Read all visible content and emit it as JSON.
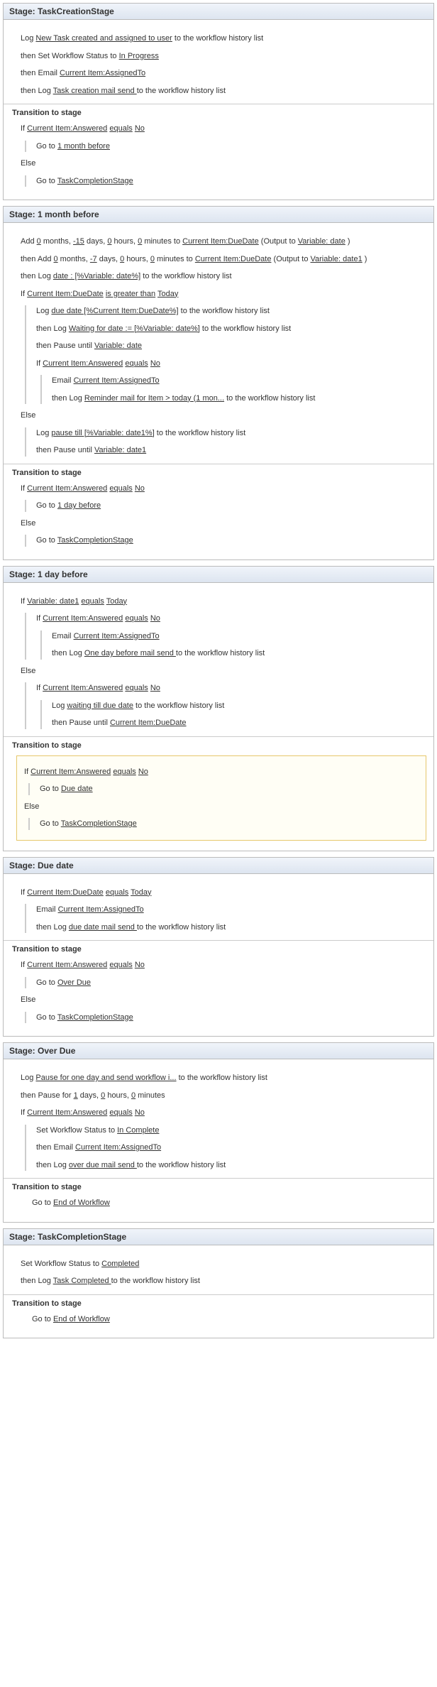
{
  "stages": {
    "creation": {
      "title": "Stage: TaskCreationStage",
      "log1_pre": "Log ",
      "log1_link": "New Task created and assigned to user",
      "log1_post": " to the workflow history list",
      "set_pre": "then Set Workflow Status to ",
      "set_link": "In Progress",
      "email_pre": "then Email ",
      "email_link": "Current Item:AssignedTo",
      "log2_pre": "then Log ",
      "log2_link": "Task creation mail send ",
      "log2_post": " to the workflow history list",
      "transition": "Transition to stage",
      "if_pre": "If ",
      "if_link1": "Current Item:Answered",
      "if_mid": " ",
      "if_link2": "equals",
      "if_link3": "No",
      "goto1_pre": "Go to ",
      "goto1_link": "1 month before",
      "else": "Else",
      "goto2_pre": "Go to ",
      "goto2_link": "TaskCompletionStage"
    },
    "month": {
      "title": "Stage: 1 month before",
      "add1_pre": "Add ",
      "add1_n1": "0",
      "add1_t1": " months, ",
      "add1_n2": "-15",
      "add1_t2": " days, ",
      "add1_n3": "0",
      "add1_t3": " hours, ",
      "add1_n4": "0",
      "add1_t4": " minutes to ",
      "add1_link": "Current Item:DueDate",
      "add1_out": " (Output to ",
      "add1_var": "Variable: date",
      "add1_end": " )",
      "add2_pre": "then Add ",
      "add2_n1": "0",
      "add2_t1": " months, ",
      "add2_n2": "-7",
      "add2_t2": " days, ",
      "add2_n3": "0",
      "add2_t3": " hours, ",
      "add2_n4": "0",
      "add2_t4": " minutes to ",
      "add2_link": "Current Item:DueDate",
      "add2_out": " (Output to ",
      "add2_var": "Variable: date1",
      "add2_end": " )",
      "log_pre": "then Log ",
      "log_link": "date : [%Variable: date%]",
      "log_post": " to the workflow history list",
      "if_pre": "If ",
      "if_l1": "Current Item:DueDate",
      "if_l2": "is greater than",
      "if_l3": "Today",
      "inner_log1_pre": "Log ",
      "inner_log1_link": "due date [%Current Item:DueDate%]",
      "inner_log1_post": " to the workflow history list",
      "inner_log2_pre": "then Log ",
      "inner_log2_link": "Waiting for date :=  [%Variable: date%]",
      "inner_log2_post": " to the workflow history list",
      "pause_pre": "then Pause until ",
      "pause_link": "Variable: date",
      "if2_pre": "If ",
      "if2_l1": "Current Item:Answered",
      "if2_l2": "equals",
      "if2_l3": "No",
      "email2_pre": "Email ",
      "email2_link": "Current Item:AssignedTo",
      "log3_pre": "then Log ",
      "log3_link": "Reminder mail for Item > today (1 mon...",
      "log3_post": " to the workflow history list",
      "else": "Else",
      "elog_pre": "Log ",
      "elog_link": "pause till [%Variable: date1%]",
      "elog_post": " to the workflow history list",
      "epause_pre": "then Pause until ",
      "epause_link": "Variable: date1",
      "transition": "Transition to stage",
      "tif_pre": "If ",
      "tif_l1": "Current Item:Answered",
      "tif_l2": "equals",
      "tif_l3": "No",
      "tgoto1_pre": "Go to ",
      "tgoto1_link": "1 day before",
      "telse": "Else",
      "tgoto2_pre": "Go to ",
      "tgoto2_link": "TaskCompletionStage"
    },
    "day": {
      "title": "Stage: 1 day before",
      "if_pre": "If ",
      "if_l1": "Variable: date1",
      "if_l2": "equals",
      "if_l3": "Today",
      "if2_pre": "If ",
      "if2_l1": "Current Item:Answered",
      "if2_l2": "equals",
      "if2_l3": "No",
      "email_pre": "Email ",
      "email_link": "Current Item:AssignedTo",
      "log_pre": "then Log ",
      "log_link": "One day before mail send ",
      "log_post": " to the workflow history list",
      "else": "Else",
      "if3_pre": "If ",
      "if3_l1": "Current Item:Answered",
      "if3_l2": "equals",
      "if3_l3": "No",
      "elog_pre": "Log ",
      "elog_link": "waiting till due date",
      "elog_post": " to the workflow history list",
      "epause_pre": "then Pause until ",
      "epause_link": "Current Item:DueDate",
      "transition": "Transition to stage",
      "tif_pre": "If ",
      "tif_l1": "Current Item:Answered",
      "tif_l2": "equals",
      "tif_l3": "No",
      "tgoto1_pre": "Go to ",
      "tgoto1_link": "Due date",
      "telse": "Else",
      "tgoto2_pre": "Go to ",
      "tgoto2_link": "TaskCompletionStage"
    },
    "due": {
      "title": "Stage: Due date",
      "if_pre": "If ",
      "if_l1": "Current Item:DueDate",
      "if_l2": "equals",
      "if_l3": "Today",
      "email_pre": "Email ",
      "email_link": "Current Item:AssignedTo",
      "log_pre": "then Log ",
      "log_link": "due date mail send ",
      "log_post": " to the workflow history list",
      "transition": "Transition to stage",
      "tif_pre": "If ",
      "tif_l1": "Current Item:Answered",
      "tif_l2": "equals",
      "tif_l3": "No",
      "tgoto1_pre": "Go to ",
      "tgoto1_link": "Over Due",
      "telse": "Else",
      "tgoto2_pre": "Go to ",
      "tgoto2_link": "TaskCompletionStage"
    },
    "over": {
      "title": "Stage: Over Due",
      "log1_pre": "Log ",
      "log1_link": "Pause for one day and send workflow i...",
      "log1_post": " to the workflow history list",
      "pause_pre": "then Pause for ",
      "pause_n1": "1",
      "pause_t1": " days, ",
      "pause_n2": "0",
      "pause_t2": " hours, ",
      "pause_n3": "0",
      "pause_t3": " minutes",
      "if_pre": "If ",
      "if_l1": "Current Item:Answered",
      "if_l2": "equals",
      "if_l3": "No",
      "set_pre": "Set Workflow Status to ",
      "set_link": "In Complete ",
      "email_pre": "then Email ",
      "email_link": "Current Item:AssignedTo",
      "log2_pre": "then Log ",
      "log2_link": "over due mail send ",
      "log2_post": " to the workflow history list",
      "transition": "Transition to stage",
      "goto_pre": "Go to ",
      "goto_link": "End of Workflow"
    },
    "complete": {
      "title": "Stage: TaskCompletionStage",
      "set_pre": "Set Workflow Status to ",
      "set_link": "Completed",
      "log_pre": "then Log ",
      "log_link": "Task Completed ",
      "log_post": " to the workflow history list",
      "transition": "Transition to stage",
      "goto_pre": "Go to ",
      "goto_link": "End of Workflow"
    }
  }
}
